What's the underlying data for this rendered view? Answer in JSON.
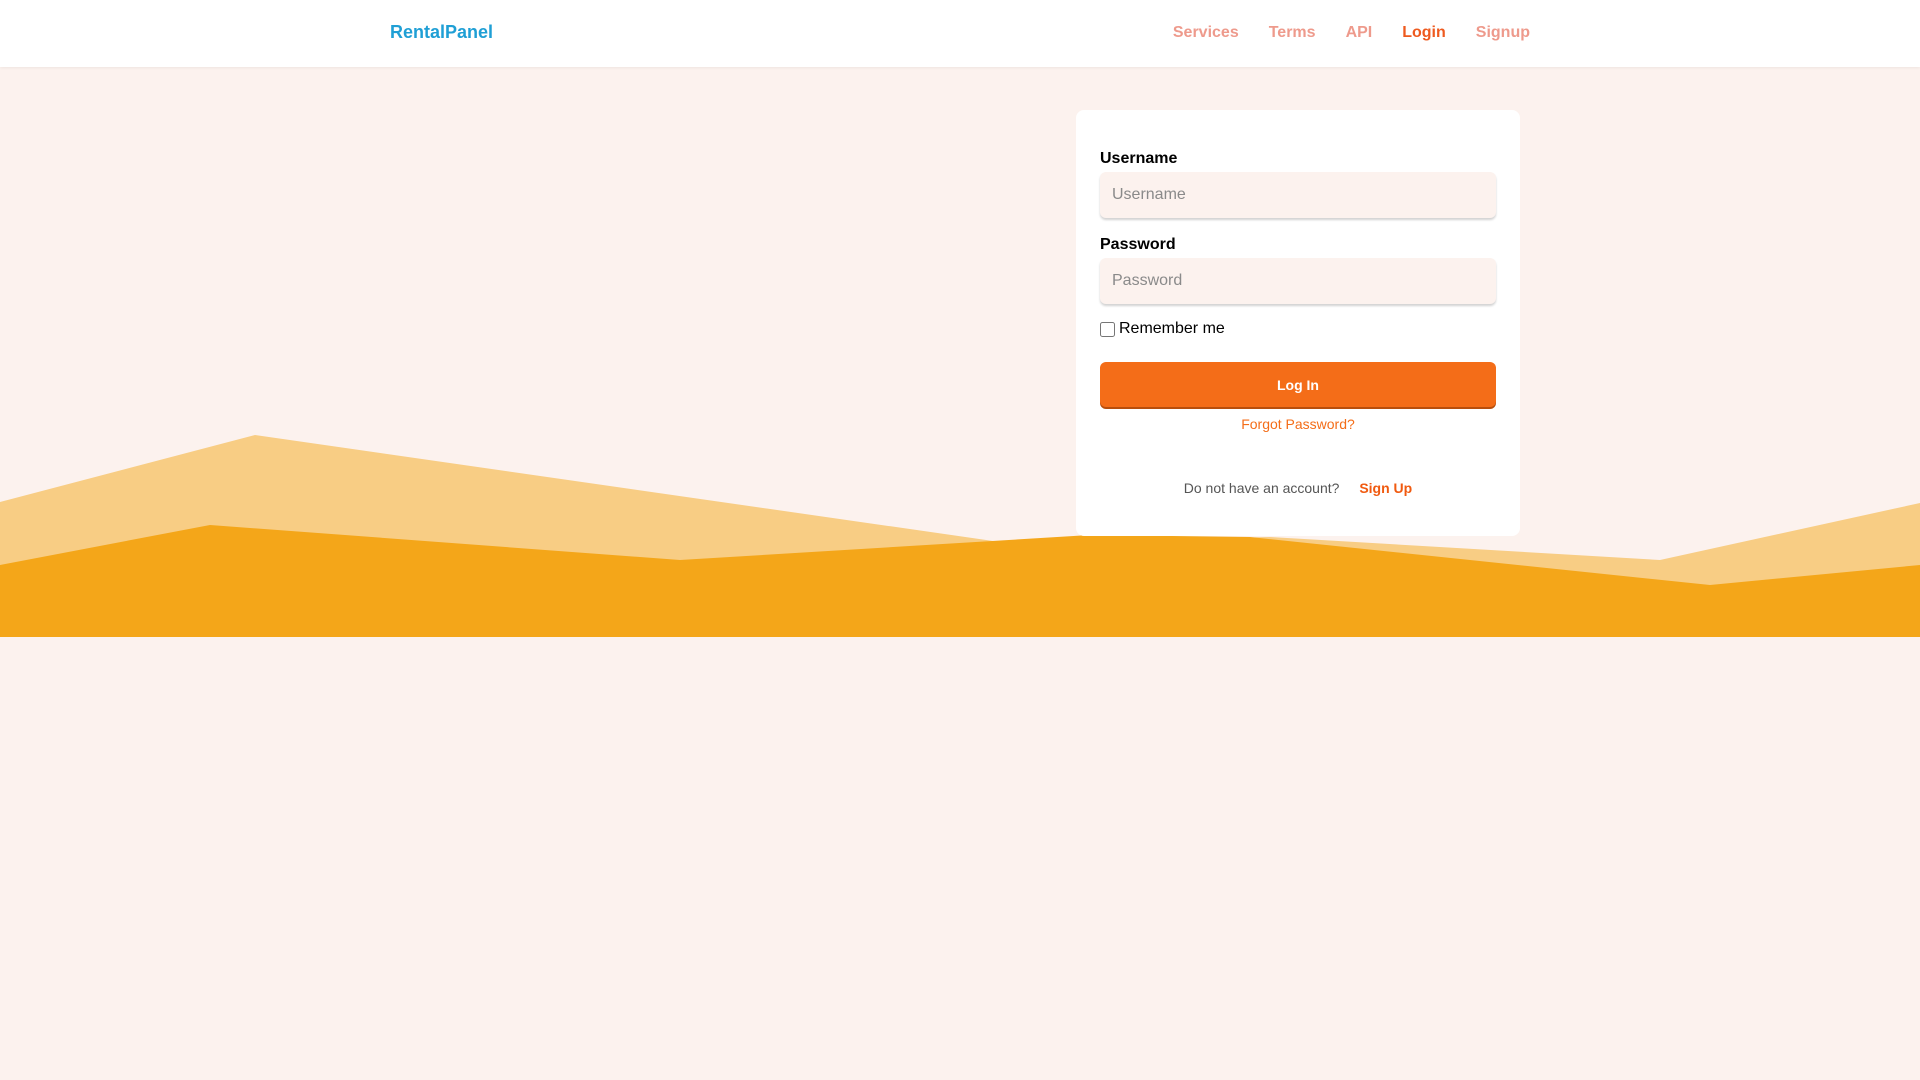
{
  "navbar": {
    "brand": "RentalPanel",
    "links": [
      {
        "label": "Services"
      },
      {
        "label": "Terms"
      },
      {
        "label": "API"
      },
      {
        "label": "Login"
      },
      {
        "label": "Signup"
      }
    ],
    "active_link": "Login"
  },
  "login_form": {
    "username_label": "Username",
    "username_placeholder": "Username",
    "username_value": "",
    "password_label": "Password",
    "password_placeholder": "Password",
    "password_value": "",
    "remember_label": "Remember me",
    "remember_checked": false,
    "submit_label": "Log In",
    "forgot_label": "Forgot Password?",
    "no_account_text": "Do not have an account?",
    "signup_label": "Sign Up"
  },
  "colors": {
    "page_background": "#fcf2ee",
    "brand": "#1f9fd5",
    "nav_link": "#ee9a8c",
    "nav_link_active": "#ee5a1f",
    "accent": "#f46d18",
    "wave_light": "#f8cd84",
    "wave_dark": "#f4a619"
  }
}
